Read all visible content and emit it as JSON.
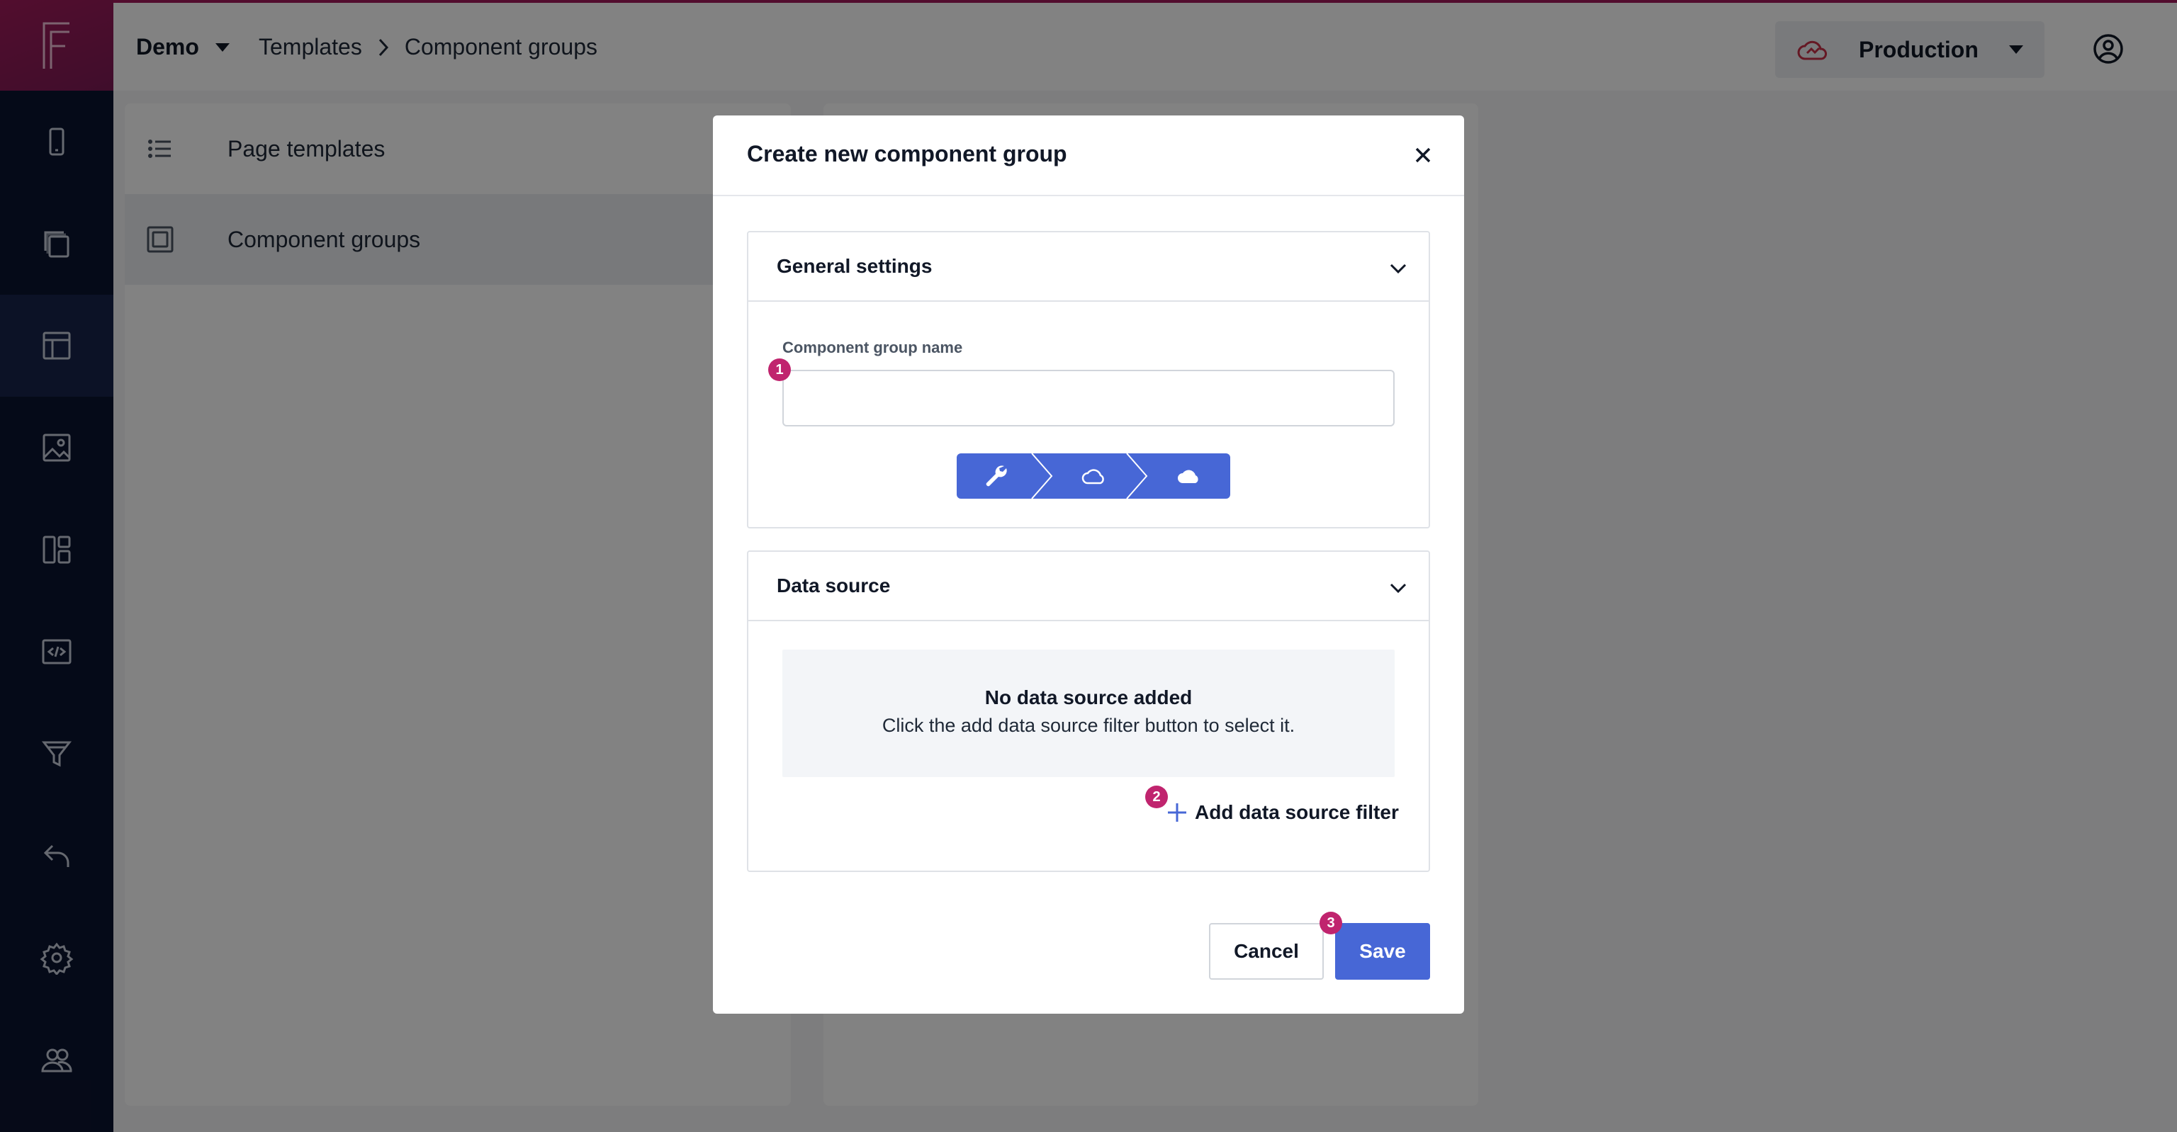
{
  "topbar": {
    "project": "Demo",
    "breadcrumb": [
      "Templates",
      "Component groups"
    ],
    "environment": "Production"
  },
  "sidebar": {
    "items": [
      {
        "icon": "mobile-icon"
      },
      {
        "icon": "pages-icon"
      },
      {
        "icon": "templates-icon",
        "active": true
      },
      {
        "icon": "media-icon"
      },
      {
        "icon": "layout-icon"
      },
      {
        "icon": "code-icon"
      },
      {
        "icon": "filter-icon"
      },
      {
        "icon": "undo-icon"
      },
      {
        "icon": "settings-icon"
      },
      {
        "icon": "users-icon"
      }
    ]
  },
  "panel": {
    "items": [
      {
        "label": "Page templates",
        "icon": "list-icon"
      },
      {
        "label": "Component groups",
        "icon": "component-icon",
        "active": true
      }
    ]
  },
  "modal": {
    "title": "Create new component group",
    "general": {
      "title": "General settings",
      "field_label": "Component group name",
      "field_value": "",
      "badge": "1"
    },
    "datasource": {
      "title": "Data source",
      "empty_title": "No data source added",
      "empty_desc": "Click the add data source filter button to select it.",
      "add_label": "Add data source filter",
      "badge": "2"
    },
    "cancel_label": "Cancel",
    "save_label": "Save",
    "save_badge": "3"
  },
  "colors": {
    "sidebar": "#0b1430",
    "brand": "#a11b5a",
    "primary": "#4767d6",
    "badge": "#c0246e"
  }
}
